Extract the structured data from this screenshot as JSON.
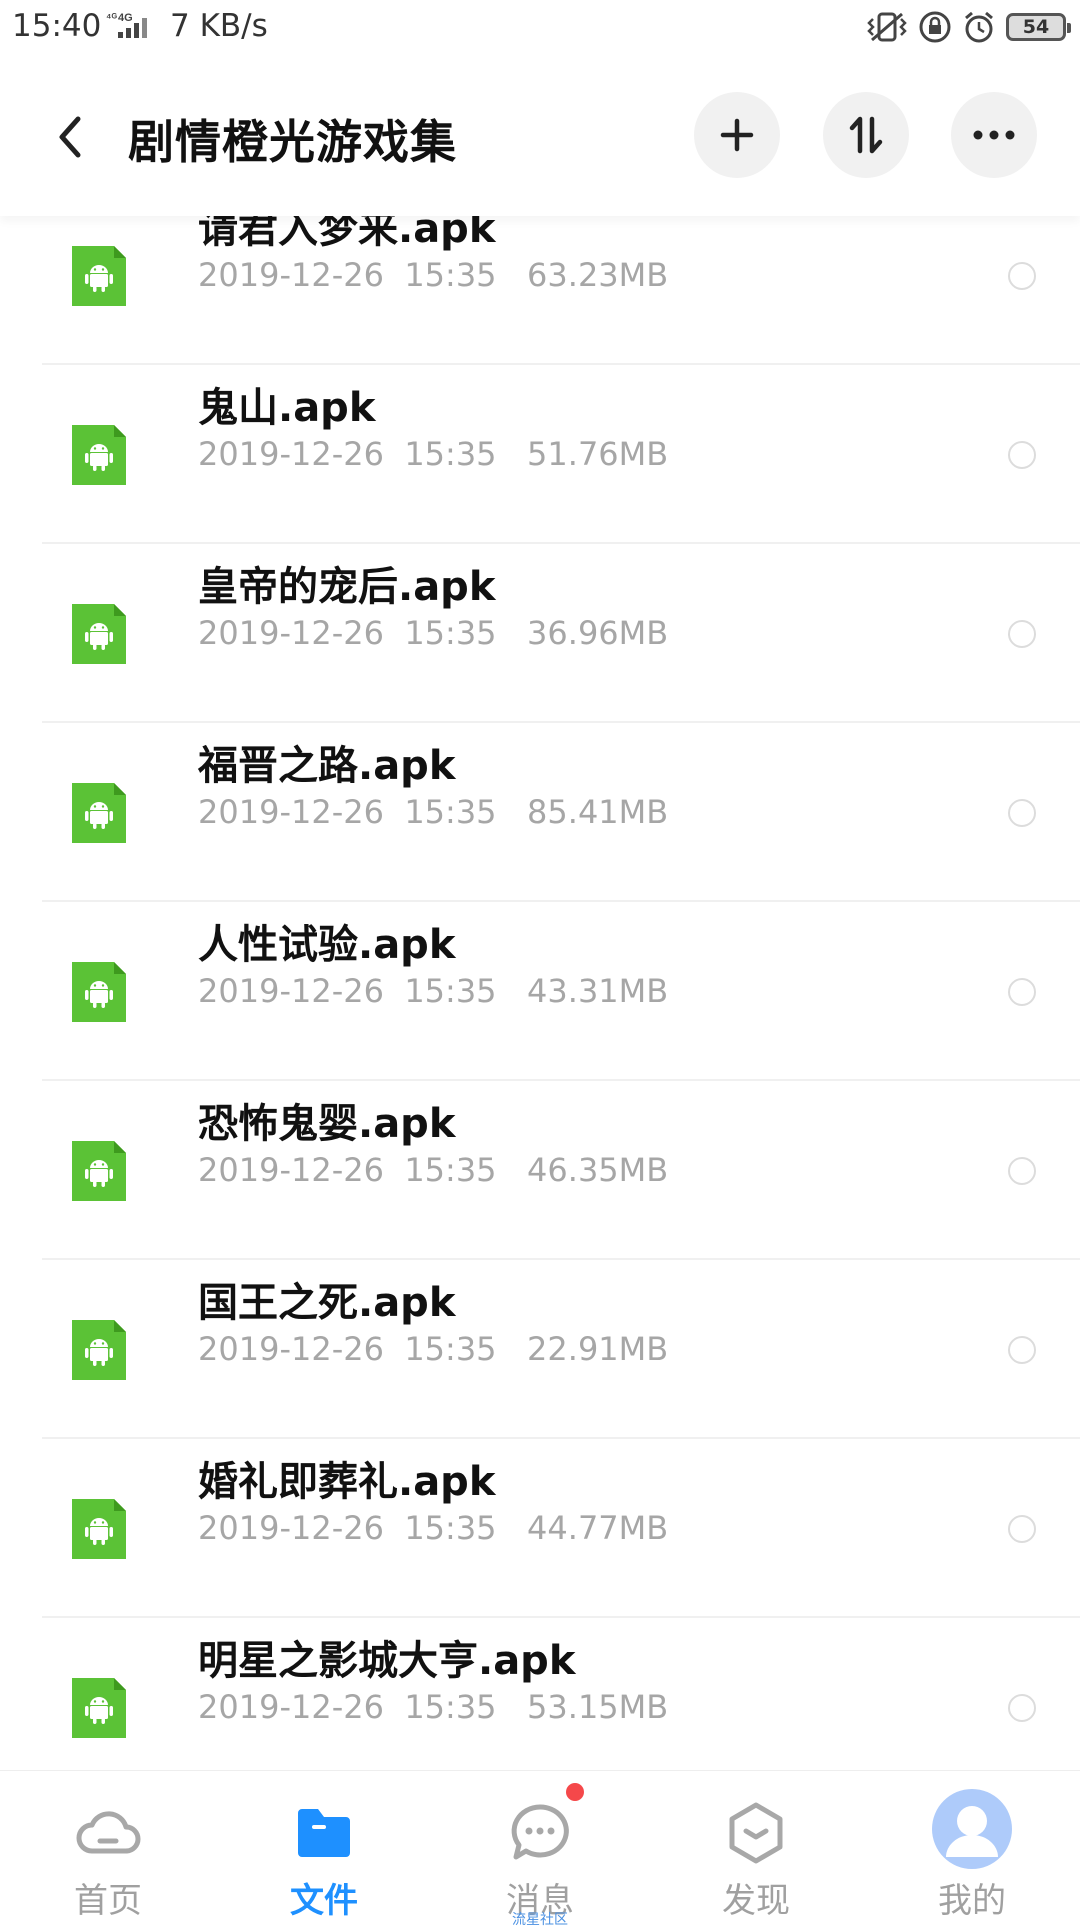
{
  "status_bar": {
    "time": "15:40",
    "network_type": "4G",
    "speed": "7 KB/s",
    "battery": "54"
  },
  "header": {
    "title": "剧情橙光游戏集"
  },
  "files": [
    {
      "name": "请君入梦来.apk",
      "date": "2019-12-26",
      "time": "15:35",
      "size": "63.23MB"
    },
    {
      "name": "鬼山.apk",
      "date": "2019-12-26",
      "time": "15:35",
      "size": "51.76MB"
    },
    {
      "name": "皇帝的宠后.apk",
      "date": "2019-12-26",
      "time": "15:35",
      "size": "36.96MB"
    },
    {
      "name": "福晋之路.apk",
      "date": "2019-12-26",
      "time": "15:35",
      "size": "85.41MB"
    },
    {
      "name": "人性试验.apk",
      "date": "2019-12-26",
      "time": "15:35",
      "size": "43.31MB"
    },
    {
      "name": "恐怖鬼婴.apk",
      "date": "2019-12-26",
      "time": "15:35",
      "size": "46.35MB"
    },
    {
      "name": "国王之死.apk",
      "date": "2019-12-26",
      "time": "15:35",
      "size": "22.91MB"
    },
    {
      "name": "婚礼即葬礼.apk",
      "date": "2019-12-26",
      "time": "15:35",
      "size": "44.77MB"
    },
    {
      "name": "明星之影城大亨.apk",
      "date": "2019-12-26",
      "time": "15:35",
      "size": "53.15MB"
    }
  ],
  "bottom_nav": {
    "items": [
      {
        "label": "首页",
        "icon": "cloud-icon"
      },
      {
        "label": "文件",
        "icon": "folder-icon",
        "active": true
      },
      {
        "label": "消息",
        "icon": "chat-icon",
        "badge": true
      },
      {
        "label": "发现",
        "icon": "discover-icon"
      },
      {
        "label": "我的",
        "icon": "avatar-icon"
      }
    ],
    "watermark": "流星社区"
  },
  "colors": {
    "accent": "#1e90ff",
    "apk_green": "#5bc236",
    "badge_red": "#f5484a"
  }
}
